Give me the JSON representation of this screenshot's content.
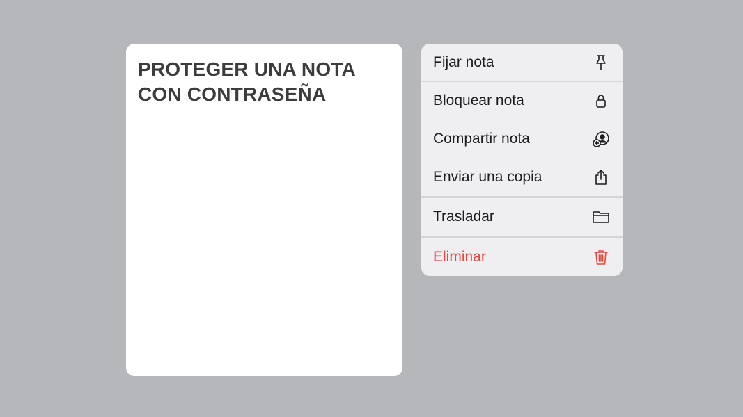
{
  "note": {
    "title_line1": "PROTEGER UNA NOTA",
    "title_line2": "CON CONTRASEÑA"
  },
  "menu": {
    "items": [
      {
        "label": "Fijar nota",
        "icon": "pin-icon"
      },
      {
        "label": "Bloquear nota",
        "icon": "lock-icon"
      },
      {
        "label": "Compartir nota",
        "icon": "share-person-add-icon"
      },
      {
        "label": "Enviar una copia",
        "icon": "share-upload-icon"
      },
      {
        "label": "Trasladar",
        "icon": "folder-icon"
      },
      {
        "label": "Eliminar",
        "icon": "trash-icon",
        "destructive": true
      }
    ]
  },
  "colors": {
    "background": "#b6b7ba",
    "menu_background": "#efeff2",
    "destructive": "#e2483b",
    "title_text": "#3c3c3e"
  }
}
